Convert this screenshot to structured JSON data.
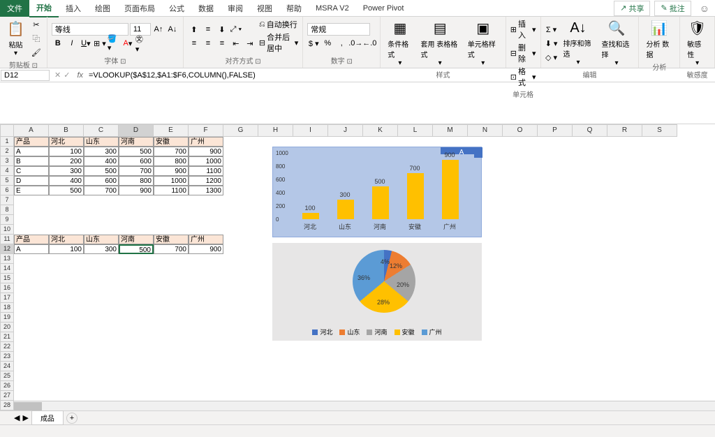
{
  "tabs": {
    "file": "文件",
    "home": "开始",
    "insert": "插入",
    "draw": "绘图",
    "layout": "页面布局",
    "formula": "公式",
    "data": "数据",
    "review": "审阅",
    "view": "视图",
    "help": "帮助",
    "msra": "MSRA V2",
    "pivot": "Power Pivot"
  },
  "header": {
    "share": "共享",
    "comment": "批注"
  },
  "ribbon": {
    "clipboard": {
      "label": "剪贴板",
      "paste": "粘贴"
    },
    "font": {
      "label": "字体",
      "name": "等线",
      "size": "11"
    },
    "align": {
      "label": "对齐方式",
      "wrap": "自动换行",
      "merge": "合并后居中"
    },
    "number": {
      "label": "数字",
      "format": "常规"
    },
    "styles": {
      "label": "样式",
      "cond": "条件格式",
      "table": "套用\n表格格式",
      "cell": "单元格样式"
    },
    "cells": {
      "label": "单元格",
      "insert": "插入",
      "delete": "删除",
      "format": "格式"
    },
    "edit": {
      "label": "编辑",
      "sort": "排序和筛选",
      "find": "查找和选择"
    },
    "analyze": {
      "label": "分析",
      "btn": "分析\n数据"
    },
    "sens": {
      "label": "敏感度",
      "btn": "敏感\n性"
    }
  },
  "namebox": "D12",
  "formula": "=VLOOKUP($A$12,$A1:$F6,COLUMN(),FALSE)",
  "columns": [
    "A",
    "B",
    "C",
    "D",
    "E",
    "F",
    "G",
    "H",
    "I",
    "J",
    "K",
    "L",
    "M",
    "N",
    "O",
    "P",
    "Q",
    "R",
    "S"
  ],
  "table": {
    "headers": [
      "产品",
      "河北",
      "山东",
      "河南",
      "安徽",
      "广州"
    ],
    "rows": [
      [
        "A",
        "100",
        "300",
        "500",
        "700",
        "900"
      ],
      [
        "B",
        "200",
        "400",
        "600",
        "800",
        "1000"
      ],
      [
        "C",
        "300",
        "500",
        "700",
        "900",
        "1100"
      ],
      [
        "D",
        "400",
        "600",
        "800",
        "1000",
        "1200"
      ],
      [
        "E",
        "500",
        "700",
        "900",
        "1100",
        "1300"
      ]
    ]
  },
  "lookup": {
    "headers": [
      "产品",
      "河北",
      "山东",
      "河南",
      "安徽",
      "广州"
    ],
    "row": [
      "A",
      "100",
      "300",
      "500",
      "700",
      "900"
    ]
  },
  "activeCell": "500",
  "chart_data": [
    {
      "type": "bar",
      "title": "A",
      "categories": [
        "河北",
        "山东",
        "河南",
        "安徽",
        "广州"
      ],
      "values": [
        100,
        300,
        500,
        700,
        900
      ],
      "ylim": [
        0,
        1000
      ],
      "yticks": [
        0,
        200,
        400,
        600,
        800,
        1000
      ]
    },
    {
      "type": "pie",
      "categories": [
        "河北",
        "山东",
        "河南",
        "安徽",
        "广州"
      ],
      "values": [
        100,
        300,
        500,
        700,
        900
      ],
      "labels": [
        "4%",
        "12%",
        "20%",
        "28%",
        "36%"
      ],
      "colors": [
        "#4472c4",
        "#ed7d31",
        "#a5a5a5",
        "#ffc000",
        "#5b9bd5"
      ]
    }
  ],
  "sheet": "成品"
}
